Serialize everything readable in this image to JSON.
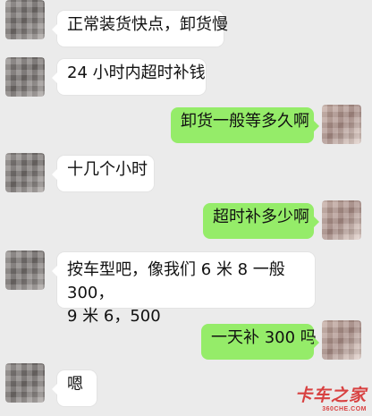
{
  "messages": [
    {
      "side": "left",
      "text": "正常装货快点，卸货慢"
    },
    {
      "side": "left",
      "text": "24 小时内超时补钱"
    },
    {
      "side": "right",
      "text": "卸货一般等多久啊"
    },
    {
      "side": "left",
      "text": "十几个小时"
    },
    {
      "side": "right",
      "text": "超时补多少啊"
    },
    {
      "side": "left",
      "lines": [
        "按车型吧，像我们 6 米 8 一般 300，",
        "9 米 6，500"
      ]
    },
    {
      "side": "right",
      "text": "一天补 300 吗"
    },
    {
      "side": "left",
      "text": "嗯"
    }
  ],
  "watermark": {
    "title": "卡车之家",
    "site": "360CHE.COM"
  }
}
